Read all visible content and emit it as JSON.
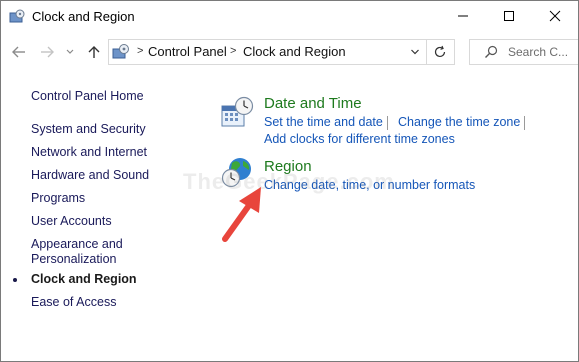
{
  "window": {
    "title": "Clock and Region"
  },
  "address": {
    "crumbs": [
      "Control Panel",
      "Clock and Region"
    ]
  },
  "search": {
    "placeholder": "Search C..."
  },
  "sidebar": {
    "home": "Control Panel Home",
    "items": [
      {
        "label": "System and Security"
      },
      {
        "label": "Network and Internet"
      },
      {
        "label": "Hardware and Sound"
      },
      {
        "label": "Programs"
      },
      {
        "label": "User Accounts"
      },
      {
        "label": "Appearance and"
      },
      {
        "label": "Personalization"
      },
      {
        "label": "Clock and Region"
      },
      {
        "label": "Ease of Access"
      }
    ],
    "current": "Clock and Region"
  },
  "sections": {
    "date_time": {
      "title": "Date and Time",
      "links": [
        "Set the time and date",
        "Change the time zone",
        "Add clocks for different time zones"
      ]
    },
    "region": {
      "title": "Region",
      "links": [
        "Change date, time, or number formats"
      ]
    }
  },
  "watermark": "TheGeekPage.com",
  "colors": {
    "section_title": "#1e7a1e",
    "link": "#1556b8",
    "arrow": "#e8453c"
  },
  "icons": [
    "control-panel-icon",
    "minimize-icon",
    "maximize-icon",
    "close-icon",
    "back-arrow-icon",
    "forward-arrow-icon",
    "chevron-down-icon",
    "up-arrow-icon",
    "refresh-icon",
    "search-icon",
    "calendar-clock-icon",
    "globe-clock-icon",
    "red-arrow-annotation"
  ]
}
